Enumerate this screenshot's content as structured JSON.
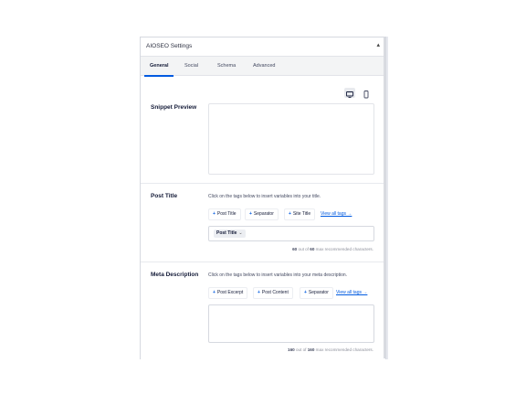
{
  "panel": {
    "title": "AIOSEO Settings",
    "toggle_icon": "triangle-up"
  },
  "tabs": [
    {
      "label": "General",
      "active": true
    },
    {
      "label": "Social"
    },
    {
      "label": "Schema"
    },
    {
      "label": "Advanced"
    }
  ],
  "snippet": {
    "label": "Snippet Preview",
    "devices": [
      "desktop-icon",
      "mobile-icon"
    ]
  },
  "post_title": {
    "label": "Post Title",
    "helper": "Click on the tags below to insert variables into your title.",
    "tags": [
      "Post Title",
      "Separator",
      "Site Title"
    ],
    "view_all": "View all tags →",
    "value_tag": "Post Title",
    "counter_count": "60",
    "counter_mid": " out of ",
    "counter_max": "60",
    "counter_tail": " max recommended characters."
  },
  "meta_description": {
    "label": "Meta Description",
    "helper": "Click on the tags below to insert variables into your meta description.",
    "tags": [
      "Post Excerpt",
      "Post Content",
      "Separator"
    ],
    "view_all": "View all tags →",
    "counter_count": "160",
    "counter_mid": " out of ",
    "counter_max": "160",
    "counter_tail": " max recommended characters."
  },
  "colors": {
    "accent": "#005ae0",
    "border": "#d6d9e0",
    "tab_bg": "#f3f4f5"
  }
}
